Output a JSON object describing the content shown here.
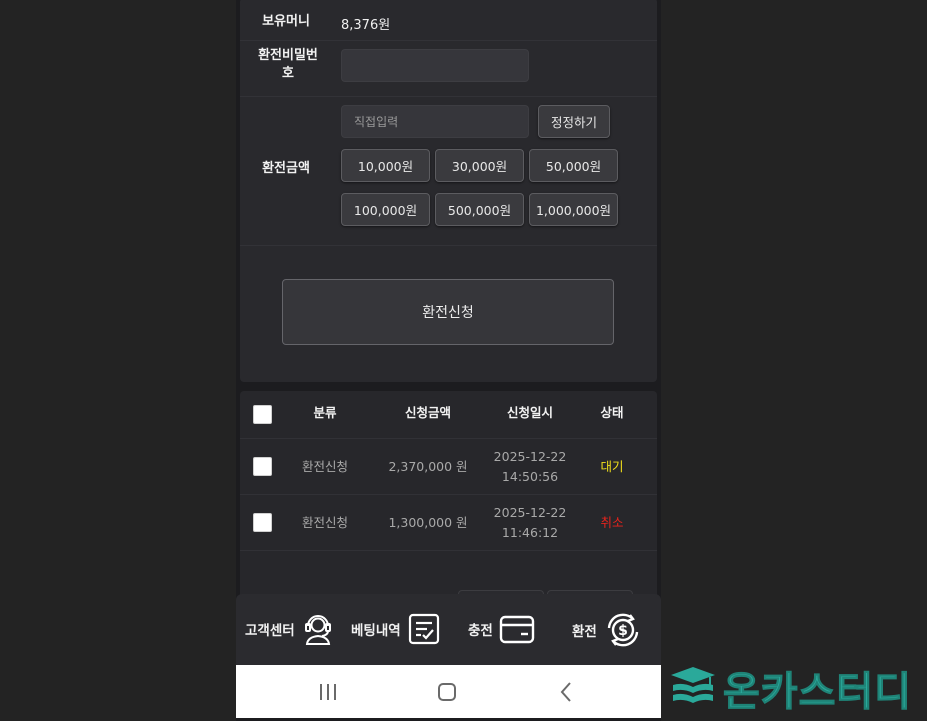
{
  "form": {
    "money_label": "보유머니",
    "money_value": "8,376원",
    "password_label": "환전비밀번호",
    "password_value": "",
    "amount_label": "환전금액",
    "amount_placeholder": "직접입력",
    "correct_button": "정정하기",
    "presets": [
      "10,000원",
      "30,000원",
      "50,000원",
      "100,000원",
      "500,000원",
      "1,000,000원"
    ],
    "apply_button": "환전신청"
  },
  "table": {
    "headers": [
      "분류",
      "신청금액",
      "신청일시",
      "상태"
    ],
    "rows": [
      {
        "type": "환전신청",
        "amount": "2,370,000 원",
        "date": "2025-12-22",
        "time": "14:50:56",
        "status": "대기",
        "status_color": "#f2e01b"
      },
      {
        "type": "환전신청",
        "amount": "1,300,000 원",
        "date": "2025-12-22",
        "time": "11:46:12",
        "status": "취소",
        "status_color": "#e8231c"
      }
    ]
  },
  "nav": {
    "items": [
      {
        "label": "고객센터",
        "icon": "headset-agent-icon"
      },
      {
        "label": "베팅내역",
        "icon": "checklist-icon"
      },
      {
        "label": "충전",
        "icon": "credit-card-icon"
      },
      {
        "label": "환전",
        "icon": "dollar-exchange-icon"
      }
    ]
  },
  "system_bar": {
    "icons": [
      "recent-apps-icon",
      "home-icon",
      "back-icon"
    ]
  },
  "watermark": {
    "text": "온카스터디",
    "icon": "book-stack-icon",
    "color": "#2aa99a"
  }
}
